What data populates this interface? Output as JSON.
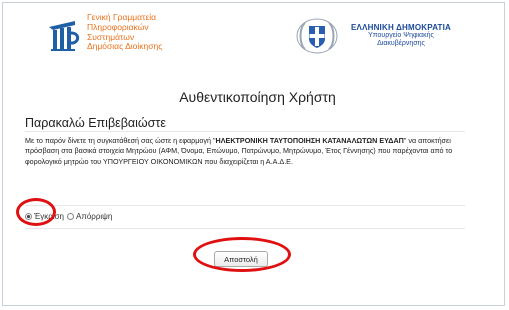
{
  "header": {
    "gsis_lines": [
      "Γενική Γραμματεία",
      "Πληροφοριακών",
      "Συστημάτων",
      "Δημόσιας Διοίκησης"
    ],
    "gov_title": "ΕΛΛΗΝΙΚΗ ΔΗΜΟΚΡΑΤΙΑ",
    "gov_sub1": "Υπουργείο Ψηφιακής",
    "gov_sub2": "Διακυβέρνησης"
  },
  "page_title": "Αυθεντικοποίηση Χρήστη",
  "section_heading": "Παρακαλώ Επιβεβαιώστε",
  "consent": {
    "part1": "Με το παρόν δίνετε τη συγκατάθεσή σας ώστε η εφαρμογή \"",
    "app_name": "ΗΛΕΚΤΡΟΝΙΚΗ ΤΑΥΤΟΠΟΙΗΣΗ ΚΑΤΑΝΑΛΩΤΩΝ ΕΥΔΑΠ",
    "part2": "\" να αποκτήσει πρόσβαση στα βασικά στοιχεία Μητρώου (ΑΦΜ, Όνομα, Επώνυμο, Πατρώνυμο, Μητρώνυμο, Έτος Γέννησης) που παρέχονται από το φορολογικό μητρώο του ΥΠΟΥΡΓΕΙΟΥ ΟΙΚΟΝΟΜΙΚΩΝ που διαχειρίζεται η Α.Α.Δ.Ε."
  },
  "options": {
    "approve_label": "Έγκριση",
    "reject_label": "Απόρριψη",
    "selected": "Έγκριση"
  },
  "submit_label": "Αποστολή",
  "colors": {
    "annotation": "#e01010",
    "gsis_orange": "#e8711a",
    "gov_blue": "#1b4a9b"
  }
}
